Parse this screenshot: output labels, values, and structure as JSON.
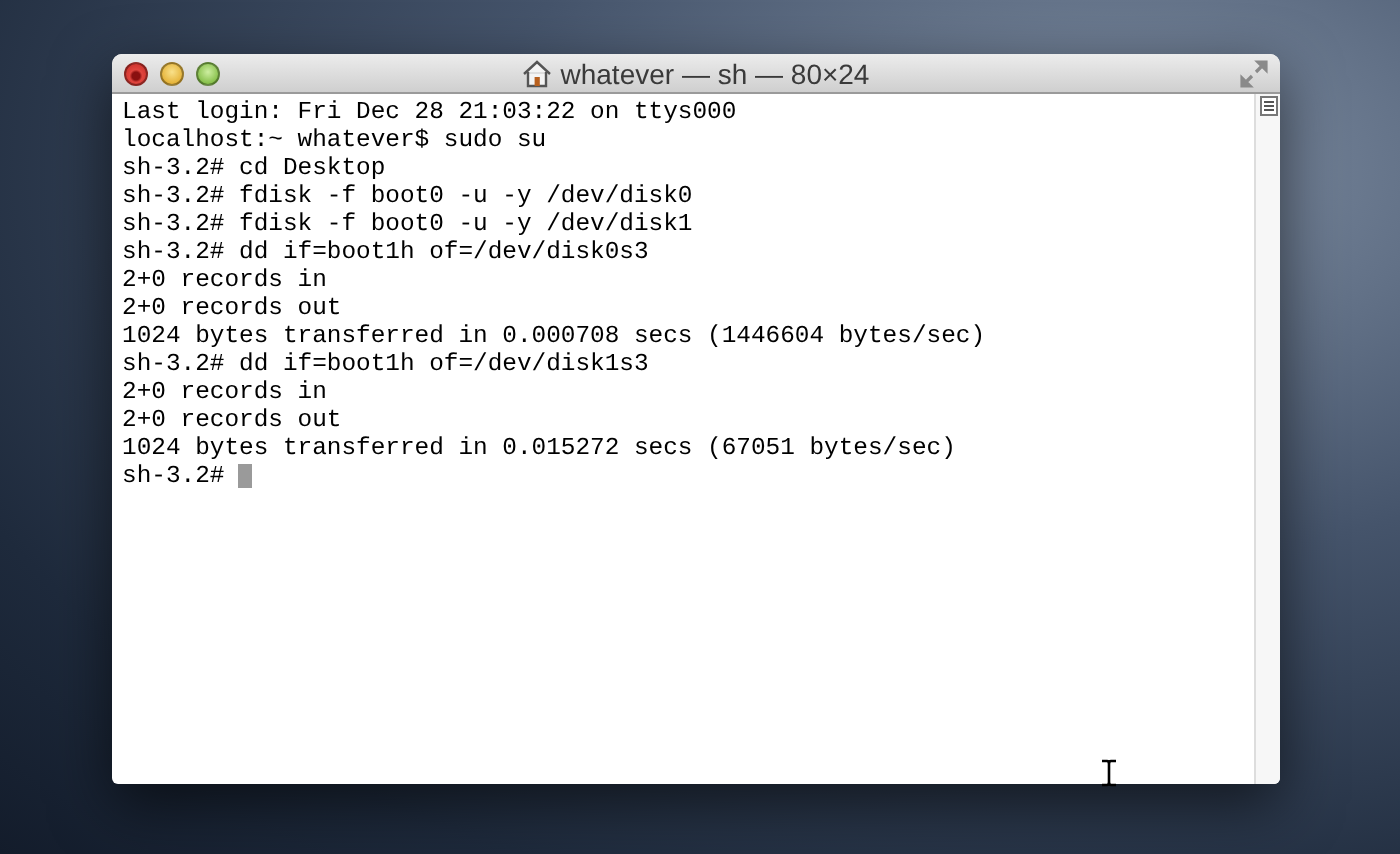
{
  "window": {
    "title": "whatever — sh — 80×24"
  },
  "terminal": {
    "lines": [
      "Last login: Fri Dec 28 21:03:22 on ttys000",
      "localhost:~ whatever$ sudo su",
      "sh-3.2# cd Desktop",
      "sh-3.2# fdisk -f boot0 -u -y /dev/disk0",
      "sh-3.2# fdisk -f boot0 -u -y /dev/disk1",
      "sh-3.2# dd if=boot1h of=/dev/disk0s3",
      "2+0 records in",
      "2+0 records out",
      "1024 bytes transferred in 0.000708 secs (1446604 bytes/sec)",
      "sh-3.2# dd if=boot1h of=/dev/disk1s3",
      "2+0 records in",
      "2+0 records out",
      "1024 bytes transferred in 0.015272 secs (67051 bytes/sec)"
    ],
    "prompt": "sh-3.2#"
  }
}
